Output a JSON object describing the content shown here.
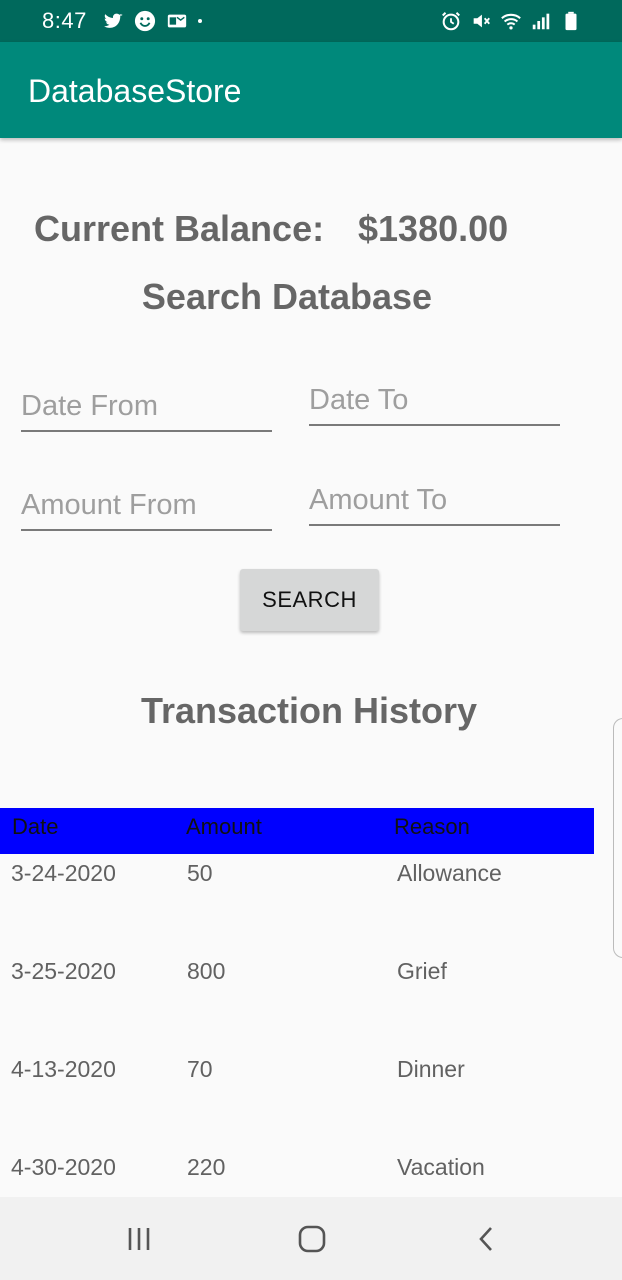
{
  "status_bar": {
    "time": "8:47",
    "left_icons": [
      "twitter-icon",
      "smiley-icon",
      "outlook-icon"
    ],
    "right_icons": [
      "alarm-icon",
      "mute-icon",
      "wifi-icon",
      "signal-icon",
      "battery-icon"
    ]
  },
  "app_bar": {
    "title": "DatabaseStore",
    "color": "#00897b"
  },
  "balance": {
    "label": "Current Balance:",
    "value": "$1380.00"
  },
  "search": {
    "title": "Search Database",
    "date_from_placeholder": "Date From",
    "date_to_placeholder": "Date To",
    "amount_from_placeholder": "Amount From",
    "amount_to_placeholder": "Amount To",
    "button_label": "SEARCH"
  },
  "history": {
    "title": "Transaction History",
    "columns": [
      "Date",
      "Amount",
      "Reason"
    ],
    "header_color": "#0000ff",
    "rows": [
      {
        "date": "3-24-2020",
        "amount": "50",
        "reason": "Allowance"
      },
      {
        "date": "3-25-2020",
        "amount": "800",
        "reason": "Grief"
      },
      {
        "date": "4-13-2020",
        "amount": "70",
        "reason": "Dinner"
      },
      {
        "date": "4-30-2020",
        "amount": "220",
        "reason": "Vacation"
      }
    ]
  },
  "nav_bar": {
    "icons": [
      "recent-apps-icon",
      "home-icon",
      "back-icon"
    ]
  }
}
